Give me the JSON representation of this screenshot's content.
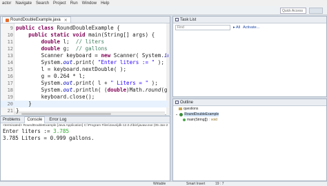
{
  "menu": [
    "actor",
    "Navigate",
    "Search",
    "Project",
    "Run",
    "Window",
    "Help"
  ],
  "toolbar": {
    "quick_access": "Quick Access"
  },
  "editor": {
    "tab_label": "RoundDoubleExample.java",
    "lines": [
      {
        "num": "9",
        "tokens": [
          [
            "kw",
            "public class "
          ],
          [
            "pl",
            "RoundDoubleExample {"
          ]
        ]
      },
      {
        "num": "10",
        "tokens": [
          [
            "pl",
            "    "
          ],
          [
            "kw",
            "public static void "
          ],
          [
            "pl",
            "main(String[] args) {"
          ]
        ]
      },
      {
        "num": "11",
        "tokens": [
          [
            "pl",
            "        "
          ],
          [
            "kw",
            "double "
          ],
          [
            "pl",
            "l;  "
          ],
          [
            "cm",
            "// liters"
          ]
        ]
      },
      {
        "num": "12",
        "tokens": [
          [
            "pl",
            "        "
          ],
          [
            "kw",
            "double "
          ],
          [
            "pl",
            "g;  "
          ],
          [
            "cm",
            "// gallons"
          ]
        ]
      },
      {
        "num": "13",
        "tokens": [
          [
            "pl",
            "        Scanner keyboard = "
          ],
          [
            "kw",
            "new "
          ],
          [
            "pl",
            "Scanner( System."
          ],
          [
            "fld",
            "in"
          ],
          [
            "pl",
            " );"
          ]
        ]
      },
      {
        "num": "14",
        "tokens": [
          [
            "pl",
            "        System."
          ],
          [
            "fld",
            "out"
          ],
          [
            "pl",
            ".print( "
          ],
          [
            "st",
            "\"Enter liters := \""
          ],
          [
            "pl",
            " );"
          ]
        ]
      },
      {
        "num": "15",
        "tokens": [
          [
            "pl",
            "        l = keyboard.nextDouble( );"
          ]
        ]
      },
      {
        "num": "16",
        "tokens": [
          [
            "pl",
            "        g = 0.264 * l;"
          ]
        ]
      },
      {
        "num": "17",
        "tokens": [
          [
            "pl",
            "        System."
          ],
          [
            "fld",
            "out"
          ],
          [
            "pl",
            ".print( l + "
          ],
          [
            "st",
            "\" Liters = \""
          ],
          [
            "pl",
            " );"
          ]
        ]
      },
      {
        "num": "18",
        "tokens": [
          [
            "pl",
            "        System."
          ],
          [
            "fld",
            "out"
          ],
          [
            "pl",
            ".println( ("
          ],
          [
            "kw",
            "double"
          ],
          [
            "pl",
            ")Math."
          ],
          [
            "mth",
            "round"
          ],
          [
            "pl",
            "(g * 10"
          ]
        ]
      },
      {
        "num": "19",
        "tokens": [
          [
            "pl",
            "        keyboard.close();"
          ]
        ]
      },
      {
        "num": "20",
        "tokens": [
          [
            "pl",
            "    }"
          ]
        ],
        "highlight": true
      },
      {
        "num": "21",
        "tokens": [
          [
            "pl",
            "}"
          ]
        ]
      },
      {
        "num": "22",
        "tokens": []
      }
    ]
  },
  "tasklist": {
    "title": "Task List",
    "find_placeholder": "Find",
    "all_label": "All",
    "activate_label": "Activate..."
  },
  "outline": {
    "title": "Outline",
    "package": "questions",
    "class_name": "RoundDoubleExample",
    "method": "main(String[])",
    "method_type": ": void"
  },
  "console": {
    "tabs": [
      "Problems",
      "Console",
      "Error Log"
    ],
    "description": "<terminated> RoundDoubleExample [Java Application] C:\\Program Files\\Java\\jdk-12.0.2\\bin\\javaw.exe (05-Jan-2",
    "prompt": "Enter liters := ",
    "input": "3.785",
    "result": "3.785 Liters = 0.999 gallons."
  },
  "status": {
    "mode": "Writable",
    "insert": "Smart Insert",
    "position": "19 : 7"
  }
}
